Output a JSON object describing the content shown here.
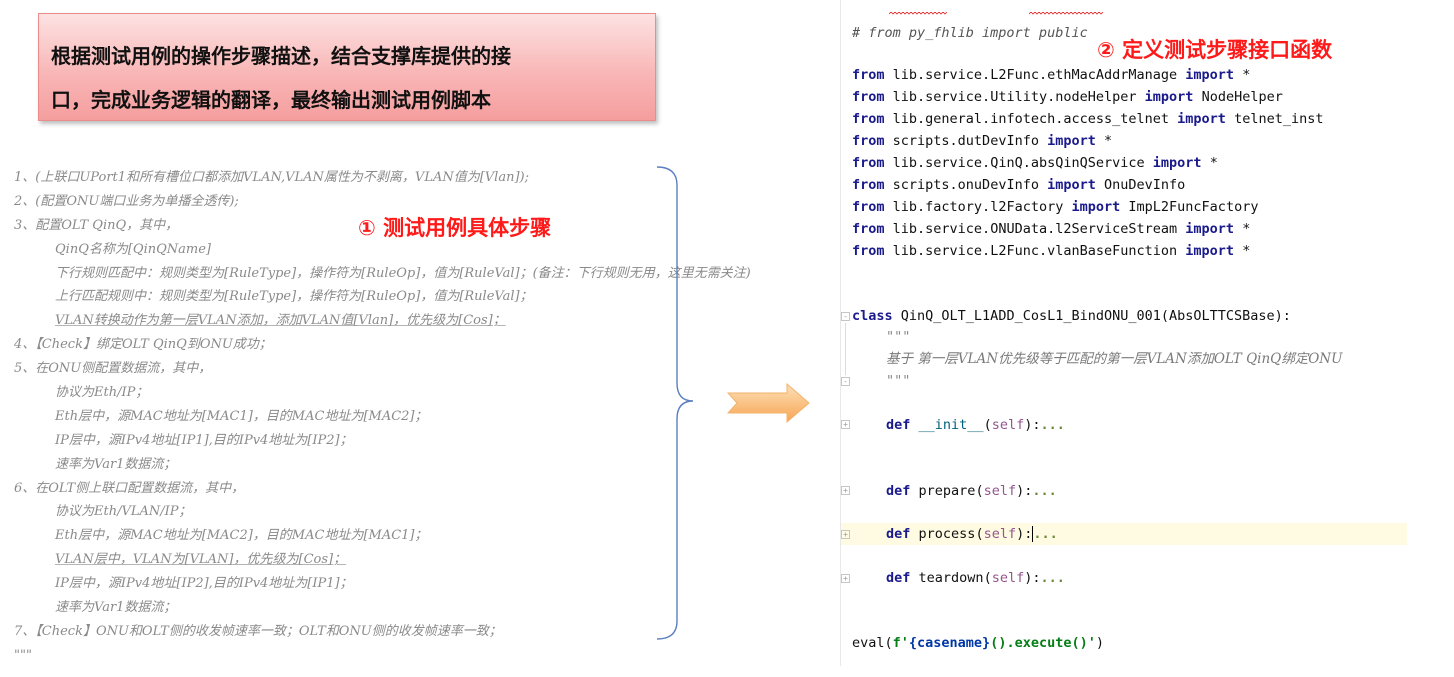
{
  "callout": {
    "line1": "根据测试用例的操作步骤描述，结合支撑库提供的接",
    "line2": "口，完成业务逻辑的翻译，最终输出测试用例脚本"
  },
  "label1": "① 测试用例具体步骤",
  "label2": "② 定义测试步骤接口函数",
  "steps": [
    "1、(上联口UPort1和所有槽位口都添加VLAN,VLAN属性为不剥离，VLAN值为[Vlan]);",
    "2、(配置ONU端口业务为单播全透传);",
    "3、配置OLT QinQ，其中，",
    "QinQ名称为[QinQName]",
    "下行规则匹配中：规则类型为[RuleType]，操作符为[RuleOp]，值为[RuleVal]；(备注：下行规则无用，这里无需关注)",
    "上行匹配规则中：规则类型为[RuleType]，操作符为[RuleOp]，值为[RuleVal]；",
    "VLAN转换动作为第一层VLAN添加，添加VLAN值[Vlan]，优先级为[Cos]；",
    "4、【Check】绑定OLT QinQ到ONU成功；",
    "5、在ONU侧配置数据流，其中，",
    "协议为Eth/IP；",
    "Eth层中，源MAC地址为[MAC1]，目的MAC地址为[MAC2]；",
    "IP层中，源IPv4地址[IP1],目的IPv4地址为[IP2]；",
    "速率为Var1数据流；",
    "6、在OLT侧上联口配置数据流，其中，",
    "协议为Eth/VLAN/IP；",
    "Eth层中，源MAC地址为[MAC2]，目的MAC地址为[MAC1]；",
    "VLAN层中，VLAN为[VLAN]，优先级为[Cos]；",
    "IP层中，源IPv4地址[IP2],目的IPv4地址为[IP1]；",
    "速率为Var1数据流；",
    "7、【Check】ONU和OLT侧的收发帧速率一致；OLT和ONU侧的收发帧速率一致；",
    "\"\"\""
  ],
  "code": {
    "comment": "# from py_fhlib import public",
    "imports": [
      {
        "module": "lib.service.L2Func.ethMacAddrManage",
        "name": "*"
      },
      {
        "module": "lib.service.Utility.nodeHelper",
        "name": "NodeHelper"
      },
      {
        "module": "lib.general.infotech.access_telnet",
        "name": "telnet_inst"
      },
      {
        "module": "scripts.dutDevInfo",
        "name": "*"
      },
      {
        "module": "lib.service.QinQ.absQinQService",
        "name": "*"
      },
      {
        "module": "scripts.onuDevInfo",
        "name": "OnuDevInfo"
      },
      {
        "module": "lib.factory.l2Factory",
        "name": "ImpL2FuncFactory"
      },
      {
        "module": "lib.service.ONUData.l2ServiceStream",
        "name": "*"
      },
      {
        "module": "lib.service.L2Func.vlanBaseFunction",
        "name": "*"
      }
    ],
    "kw_from": "from",
    "kw_import": "import",
    "kw_class": "class",
    "kw_def": "def",
    "class_name": "QinQ_OLT_L1ADD_CosL1_BindONU_001(AbsOLTTCSBase):",
    "docstring_quote": "\"\"\"",
    "docstring_text": "基于 第一层VLAN优先级等于匹配的第一层VLAN添加OLT QinQ绑定ONU",
    "methods": [
      "__init__",
      "prepare",
      "process",
      "teardown"
    ],
    "self": "self",
    "eval_line": {
      "fn": "eval(",
      "fprefix": "f'",
      "brace": "{casename}",
      "rest": "().execute()'",
      "close": ")"
    }
  }
}
